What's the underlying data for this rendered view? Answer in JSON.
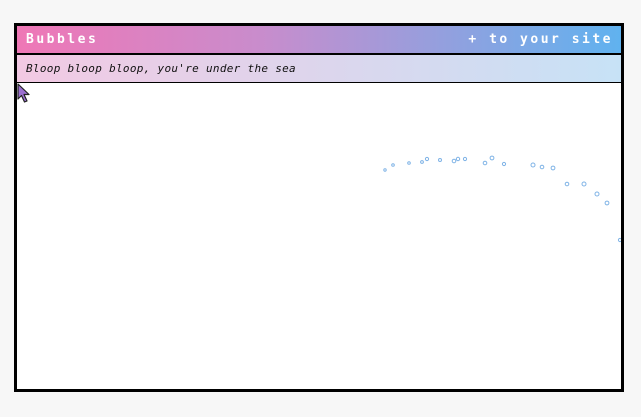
{
  "window": {
    "title": "Bubbles",
    "action_label": "+ to your site",
    "subtitle": "Bloop bloop bloop, you're under the sea"
  },
  "colors": {
    "title_gradient_start": "#ef77b6",
    "title_gradient_mid": "#c98ccc",
    "title_gradient_end": "#60b2ef",
    "sub_gradient_start": "#f2c9e3",
    "sub_gradient_end": "#c7e2f6",
    "bubble": "#7fb3e6",
    "cursor_fill": "#9b6fcf"
  },
  "icons": {
    "pointer": "mouse-cursor-icon"
  }
}
